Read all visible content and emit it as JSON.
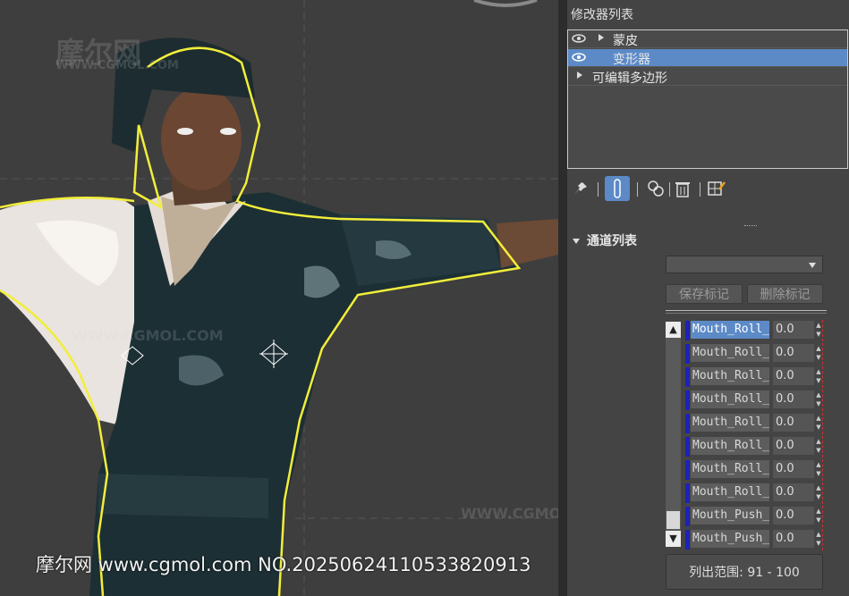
{
  "viewport": {
    "watermarks": [
      "摩尔网",
      "WWW.CGMOL.COM"
    ],
    "bottom_watermark": "摩尔网 www.cgmol.com NO.20250624110533820913"
  },
  "panel": {
    "modifier_list_title": "修改器列表",
    "modifiers": [
      {
        "label": "蒙皮",
        "visible": true,
        "expanded": false,
        "selected": false
      },
      {
        "label": "变形器",
        "visible": true,
        "expanded": false,
        "selected": true
      },
      {
        "label": "可编辑多边形",
        "visible": false,
        "expanded": false,
        "selected": false
      }
    ],
    "toolbar": {
      "icons": [
        "pin-stack-icon",
        "show-end-result-icon",
        "make-unique-icon",
        "remove-modifier-icon",
        "configure-sets-icon"
      ]
    },
    "channel_rollout": {
      "title": "通道列表",
      "dropdown_value": "",
      "save_marker_label": "保存标记",
      "delete_marker_label": "删除标记",
      "channels": [
        {
          "name": "Mouth_Roll_",
          "value": "0.0"
        },
        {
          "name": "Mouth_Roll_",
          "value": "0.0"
        },
        {
          "name": "Mouth_Roll_",
          "value": "0.0"
        },
        {
          "name": "Mouth_Roll_",
          "value": "0.0"
        },
        {
          "name": "Mouth_Roll_",
          "value": "0.0"
        },
        {
          "name": "Mouth_Roll_",
          "value": "0.0"
        },
        {
          "name": "Mouth_Roll_",
          "value": "0.0"
        },
        {
          "name": "Mouth_Roll_",
          "value": "0.0"
        },
        {
          "name": "Mouth_Push_",
          "value": "0.0"
        },
        {
          "name": "Mouth_Push_",
          "value": "0.0"
        }
      ],
      "range_label": "列出范围: 91 - 100"
    }
  },
  "colors": {
    "selection_blue": "#5c8ac7",
    "channel_bar": "#1e22b8",
    "selection_outline": "#f2ee3a"
  }
}
